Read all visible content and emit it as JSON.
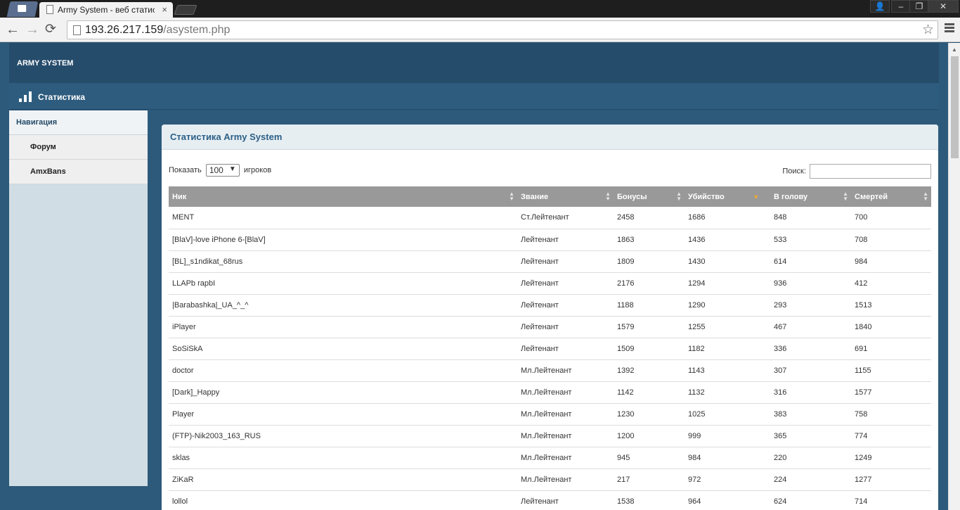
{
  "browser": {
    "tab_title": "Army System - веб статис",
    "tab_close": "×",
    "url_host": "193.26.217.159",
    "url_path": "/asystem.php",
    "controls": {
      "user": "👤",
      "minimize": "–",
      "restore": "❐",
      "close": "✕"
    }
  },
  "site": {
    "brand": "ARMY SYSTEM",
    "section_label": "Статистика"
  },
  "sidebar": {
    "heading": "Навигация",
    "items": [
      {
        "label": "Форум"
      },
      {
        "label": "AmxBans"
      }
    ]
  },
  "panel": {
    "title": "Статистика Army System",
    "show_prefix": "Показать",
    "page_size": "100",
    "show_suffix": "игроков",
    "search_label": "Поиск:",
    "search_value": ""
  },
  "table": {
    "columns": [
      "Ник",
      "Звание",
      "Бонусы",
      "Убийство",
      "В голову",
      "Смертей"
    ],
    "sorted_column": "Убийство",
    "rows": [
      [
        "MENT",
        "Ст.Лейтенант",
        "2458",
        "1686",
        "848",
        "700"
      ],
      [
        "[BlaV]-love iPhone 6-[BlaV]",
        "Лейтенант",
        "1863",
        "1436",
        "533",
        "708"
      ],
      [
        "[BL]_s1ndikat_68rus",
        "Лейтенант",
        "1809",
        "1430",
        "614",
        "984"
      ],
      [
        "LLAPb rapbI",
        "Лейтенант",
        "2176",
        "1294",
        "936",
        "412"
      ],
      [
        "|Barabashka|_UA_^_^",
        "Лейтенант",
        "1188",
        "1290",
        "293",
        "1513"
      ],
      [
        "iPlayer",
        "Лейтенант",
        "1579",
        "1255",
        "467",
        "1840"
      ],
      [
        "SoSiSkA",
        "Лейтенант",
        "1509",
        "1182",
        "336",
        "691"
      ],
      [
        "doctor",
        "Мл.Лейтенант",
        "1392",
        "1143",
        "307",
        "1155"
      ],
      [
        "[Dark]_Happy",
        "Мл.Лейтенант",
        "1142",
        "1132",
        "316",
        "1577"
      ],
      [
        "Player",
        "Мл.Лейтенант",
        "1230",
        "1025",
        "383",
        "758"
      ],
      [
        "(FTP)-Nik2003_163_RUS",
        "Мл.Лейтенант",
        "1200",
        "999",
        "365",
        "774"
      ],
      [
        "sklas",
        "Мл.Лейтенант",
        "945",
        "984",
        "220",
        "1249"
      ],
      [
        "ZiKaR",
        "Мл.Лейтенант",
        "217",
        "972",
        "224",
        "1277"
      ],
      [
        "lollol",
        "Лейтенант",
        "1538",
        "964",
        "624",
        "714"
      ]
    ]
  }
}
